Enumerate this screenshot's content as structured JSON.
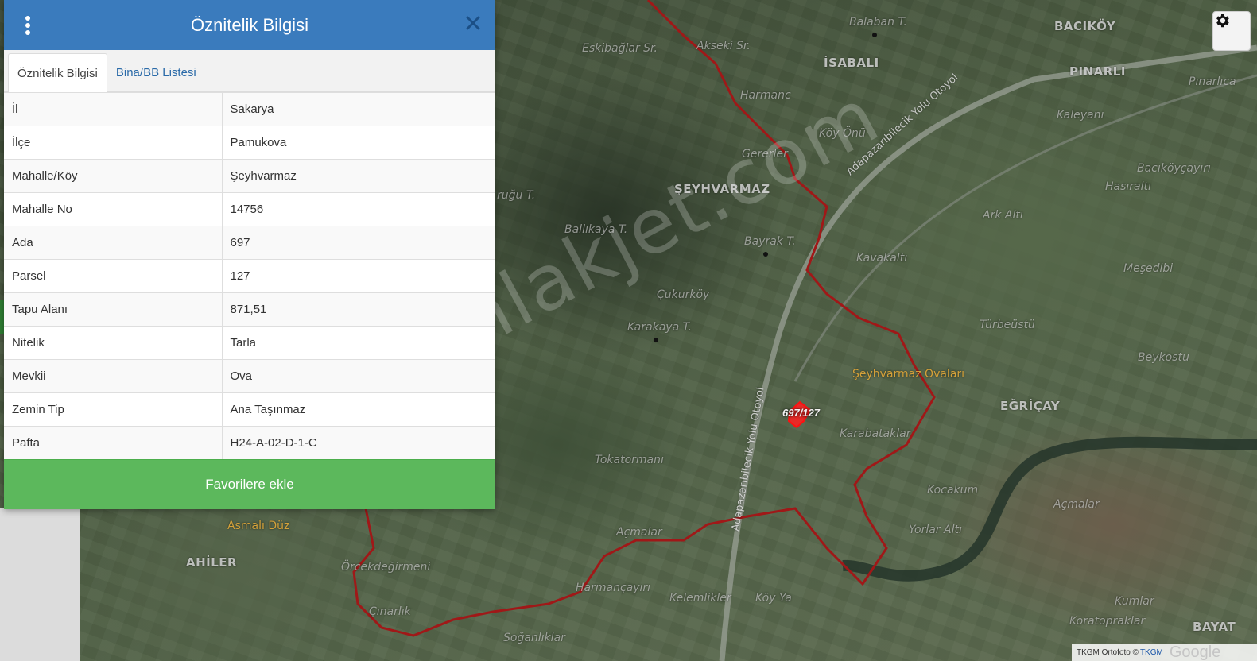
{
  "panel": {
    "title": "Öznitelik Bilgisi",
    "tabs": [
      {
        "label": "Öznitelik Bilgisi",
        "active": true
      },
      {
        "label": "Bina/BB Listesi",
        "active": false
      }
    ],
    "rows": [
      {
        "key": "İl",
        "value": "Sakarya"
      },
      {
        "key": "İlçe",
        "value": "Pamukova"
      },
      {
        "key": "Mahalle/Köy",
        "value": "Şeyhvarmaz"
      },
      {
        "key": "Mahalle No",
        "value": "14756"
      },
      {
        "key": "Ada",
        "value": "697"
      },
      {
        "key": "Parsel",
        "value": "127"
      },
      {
        "key": "Tapu Alanı",
        "value": "871,51"
      },
      {
        "key": "Nitelik",
        "value": "Tarla"
      },
      {
        "key": "Mevkii",
        "value": "Ova"
      },
      {
        "key": "Zemin Tip",
        "value": "Ana Taşınmaz"
      },
      {
        "key": "Pafta",
        "value": "H24-A-02-D-1-C"
      }
    ],
    "favorite_button": "Favorilere ekle",
    "header_color": "#3a7bbd",
    "button_color": "#5cb85c"
  },
  "map": {
    "labels": {
      "eskibaglar": "Eskibağlar Sr.",
      "akseki": "Akseki Sr.",
      "balaban": "Balaban T.",
      "bacikoy": "BACIKÖY",
      "isabali": "İSABALI",
      "pinarli": "PINARLI",
      "pinarlica": "Pınarlıca",
      "harmanc": "Harmanc",
      "koyonu": "Köy Önü",
      "kaleyani": "Kaleyanı",
      "gererler": "Gererler",
      "seyhvarmaz": "ŞEYHVARMAZ",
      "bacikoycayiri": "Bacıköyçayırı",
      "hasiralti": "Hasıraltı",
      "rugu": "ruğu T.",
      "arkalti": "Ark Altı",
      "ballikaya": "Ballıkaya T.",
      "bayrak": "Bayrak T.",
      "kavakalti": "Kavakaltı",
      "mesedibi": "Meşedibi",
      "cukurkoy": "Çukurköy",
      "turbeustu": "Türbeüstü",
      "karakaya": "Karakaya T.",
      "beykostu": "Beykostu",
      "seyhvarmaz_ovalari": "Şeyhvarmaz Ovaları",
      "egricay": "EĞRİÇAY",
      "karabataklar": "Karabataklar",
      "tokatormani": "Tokatormanı",
      "kocakum": "Kocakum",
      "acmalar_right": "Açmalar",
      "asmali_duz": "Asmalı Düz",
      "acmalar": "Açmalar",
      "yorlar_alti": "Yorlar Altı",
      "ahiler": "AHİLER",
      "orcekdegirmeni": "Örcekdeğirmeni",
      "harmancayiri": "Harmançayırı",
      "kelemlikler": "Kelemlikler",
      "koyya": "Köy Ya",
      "kumlar": "Kumlar",
      "cinarlik": "Çınarlık",
      "koratopraklar": "Koratopraklar",
      "soganliklar": "Soğanlıklar",
      "bayat": "BAYAT",
      "road_upper": "Adapazarıbilecik Yolu Otoyol",
      "road_lower": "Adapazarıbilecik Yolu Otoyol"
    },
    "parcel_label": "697/127",
    "watermark": "emlakjet.com",
    "attribution_prefix": "TKGM Ortofoto ©",
    "attribution_link": "TKGM",
    "attribution_google": "Google",
    "boundary_color": "#a01818",
    "parcel_color": "#ff1010"
  },
  "icons": {
    "settings": "gear-icon",
    "menu": "vertical-dots-icon",
    "close": "close-icon"
  }
}
